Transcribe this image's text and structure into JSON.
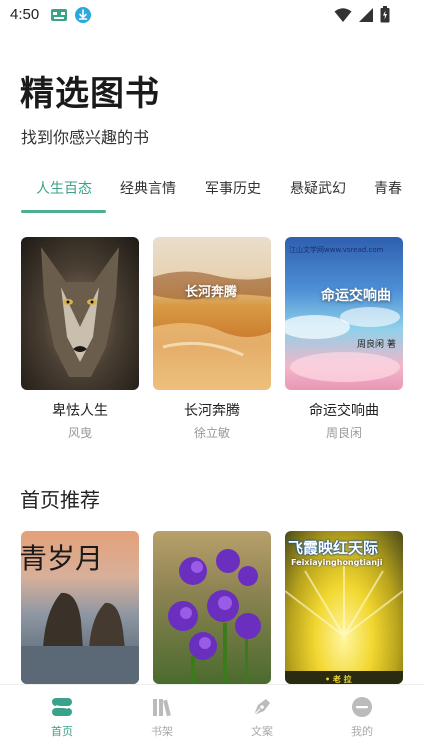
{
  "status": {
    "time": "4:50"
  },
  "hero": {
    "title": "精选图书",
    "subtitle": "找到你感兴趣的书"
  },
  "tabs": [
    {
      "label": "人生百态",
      "active": true
    },
    {
      "label": "经典言情",
      "active": false
    },
    {
      "label": "军事历史",
      "active": false
    },
    {
      "label": "悬疑武幻",
      "active": false
    },
    {
      "label": "青春",
      "active": false
    }
  ],
  "featured_books": [
    {
      "title": "卑怯人生",
      "author": "风曳",
      "cover_text": ""
    },
    {
      "title": "长河奔腾",
      "author": "徐立敏",
      "cover_text": "长河奔腾"
    },
    {
      "title": "命运交响曲",
      "author": "周良闲",
      "cover_text": "命运交响曲",
      "cover_url": "江山文学网www.vsread.com",
      "cover_author": "周良闲 著"
    }
  ],
  "recommend": {
    "title": "首页推荐",
    "books": [
      {
        "cover_text": "青岁月"
      },
      {
        "cover_text": ""
      },
      {
        "cover_text": "飞霞映红天际",
        "cover_sub": "Feixiayinghongtianji",
        "cover_author": "• 老 拉"
      }
    ]
  },
  "bottom_nav": [
    {
      "label": "首页",
      "icon": "home-icon",
      "active": true
    },
    {
      "label": "书架",
      "icon": "bookshelf-icon",
      "active": false
    },
    {
      "label": "文案",
      "icon": "pen-icon",
      "active": false
    },
    {
      "label": "我的",
      "icon": "profile-icon",
      "active": false
    }
  ],
  "colors": {
    "accent": "#3aa28a",
    "inactive": "#aaaaaa"
  }
}
